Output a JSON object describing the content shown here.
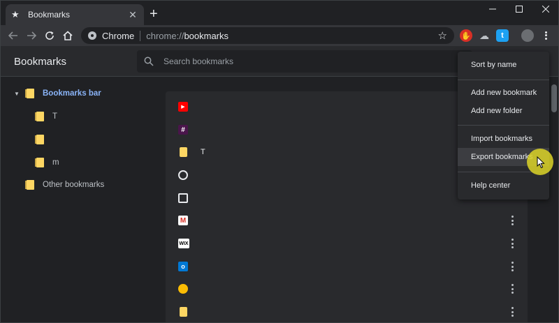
{
  "browser": {
    "tab_title": "Bookmarks",
    "new_tab_symbol": "+",
    "omnibox": {
      "chip": "Chrome",
      "scheme": "chrome://",
      "host": "bookmarks"
    }
  },
  "app": {
    "title": "Bookmarks",
    "search_placeholder": "Search bookmarks"
  },
  "sidebar": {
    "items": [
      {
        "label": "Bookmarks bar",
        "selected": true,
        "level": 0,
        "expanded": true
      },
      {
        "label": "T",
        "level": 1
      },
      {
        "label": "",
        "level": 1
      },
      {
        "label": "m",
        "level": 1
      },
      {
        "label": "Other bookmarks",
        "level": 0
      }
    ]
  },
  "bookmarks": [
    {
      "title": "",
      "icon": "youtube-icon",
      "color": "#ff0000"
    },
    {
      "title": "",
      "icon": "slack-icon",
      "color": "#4a154b"
    },
    {
      "title": "T",
      "icon": "folder-icon",
      "color": "#fdd663"
    },
    {
      "title": "",
      "icon": "github-icon",
      "color": "#ffffff"
    },
    {
      "title": "",
      "icon": "screen-icon",
      "color": "#ffffff"
    },
    {
      "title": "",
      "icon": "gmail-icon",
      "color": "#d93025"
    },
    {
      "title": "",
      "icon": "wix-icon",
      "color": "#ffffff",
      "text": "WIX"
    },
    {
      "title": "",
      "icon": "outlook-icon",
      "color": "#0078d4"
    },
    {
      "title": "",
      "icon": "bulb-icon",
      "color": "#fbbc04"
    },
    {
      "title": "",
      "icon": "folder-icon",
      "color": "#fdd663"
    }
  ],
  "menu": {
    "sort": "Sort by name",
    "add_bookmark": "Add new bookmark",
    "add_folder": "Add new folder",
    "import": "Import bookmarks",
    "export": "Export bookmarks",
    "help": "Help center"
  }
}
